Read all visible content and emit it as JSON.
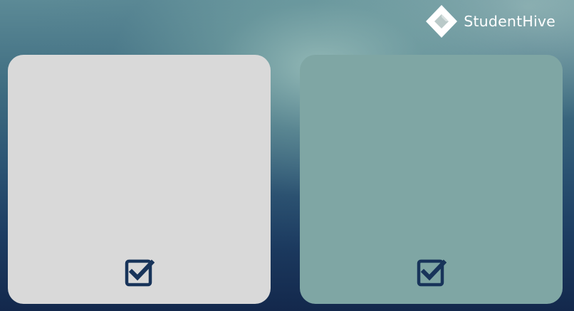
{
  "brand": {
    "name": "StudentHive",
    "logo_icon": "diamond-logo-icon"
  },
  "cards": [
    {
      "id": "left",
      "background": "#d9d9d9",
      "icon": "checkbox-checked-icon"
    },
    {
      "id": "right",
      "background": "#7fa6a4",
      "icon": "checkbox-checked-icon"
    }
  ],
  "colors": {
    "icon": "#18345a",
    "text": "#ffffff"
  }
}
